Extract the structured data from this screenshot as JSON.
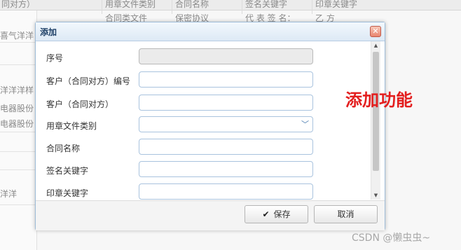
{
  "background": {
    "header": [
      "同对方）",
      "用章文件类别",
      "合同名称",
      "签名关键字",
      "印章关键字"
    ],
    "row2": [
      "合同类文件",
      "保密协议",
      "代 表 签 名：",
      "乙 方"
    ],
    "left_cells": [
      "喜气洋洋",
      "洋洋洋样",
      "电器股份",
      "电器股份",
      "洋洋"
    ]
  },
  "dialog": {
    "title": "添加",
    "close_glyph": "✕",
    "fields": [
      {
        "label": "序号",
        "value": "",
        "disabled": true
      },
      {
        "label": "客户（合同对方）编号",
        "value": ""
      },
      {
        "label": "客户（合同对方）",
        "value": ""
      },
      {
        "label": "用章文件类别",
        "value": "",
        "dropdown": true
      },
      {
        "label": "合同名称",
        "value": ""
      },
      {
        "label": "签名关键字",
        "value": ""
      },
      {
        "label": "印章关键字",
        "value": ""
      }
    ],
    "scroll_up": "▲",
    "scroll_down": "▼",
    "save_label": "保存",
    "save_icon": "✔",
    "cancel_label": "取消",
    "dropdown_glyph": "﹀"
  },
  "annotation": "添加功能",
  "watermark": "CSDN @懒虫虫~",
  "colors": {
    "annotation": "#e31e1e",
    "title_text": "#1d3f66",
    "field_border": "#a9c3de"
  }
}
